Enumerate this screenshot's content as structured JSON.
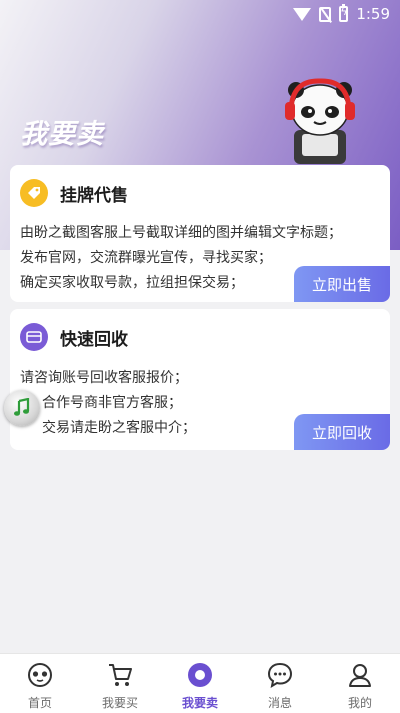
{
  "status_bar": {
    "time": "1:59"
  },
  "header": {
    "title": "我要卖"
  },
  "cards": {
    "sell": {
      "title": "挂牌代售",
      "lines": [
        "由盼之截图客服上号截取详细的图并编辑文字标题；",
        "发布官网，交流群曝光宣传，寻找买家；",
        "确定买家收取号款，拉组担保交易；"
      ],
      "button": "立即出售"
    },
    "recycle": {
      "title": "快速回收",
      "lines": [
        "请咨询账号回收客服报价；",
        "合作号商非官方客服；",
        "交易请走盼之客服中介；"
      ],
      "button": "立即回收"
    }
  },
  "tabbar": {
    "items": [
      {
        "label": "首页",
        "icon": "home-panda-icon"
      },
      {
        "label": "我要买",
        "icon": "cart-icon"
      },
      {
        "label": "我要卖",
        "icon": "sell-icon"
      },
      {
        "label": "消息",
        "icon": "message-icon"
      },
      {
        "label": "我的",
        "icon": "profile-icon"
      }
    ],
    "active_index": 2
  },
  "colors": {
    "accent": "#6a4fd0",
    "button_gradient_start": "#7f97f3",
    "button_gradient_end": "#6a6be6",
    "sell_icon_bg": "#f7bd24",
    "recycle_icon_bg": "#7a5bd6"
  }
}
